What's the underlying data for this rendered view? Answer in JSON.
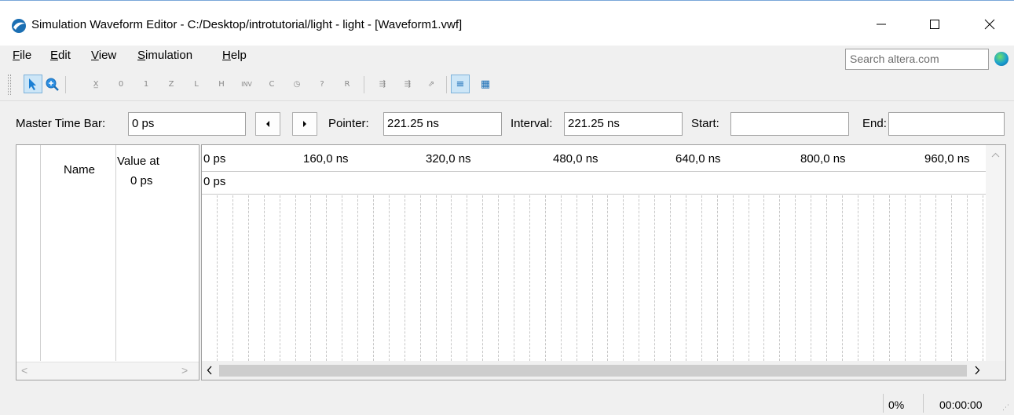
{
  "window": {
    "title": "Simulation Waveform Editor - C:/Desktop/introtutorial/light - light - [Waveform1.vwf]",
    "app_icon": "quartus-app-icon",
    "controls": [
      "minimize-icon",
      "maximize-icon",
      "close-icon"
    ]
  },
  "menu": {
    "items": [
      {
        "prefix": "",
        "u": "F",
        "rest": "ile"
      },
      {
        "prefix": "",
        "u": "E",
        "rest": "dit"
      },
      {
        "prefix": "",
        "u": "V",
        "rest": "iew"
      },
      {
        "prefix": "",
        "u": "S",
        "rest": "imulation"
      },
      {
        "prefix": "",
        "u": "H",
        "rest": "elp"
      }
    ],
    "search_placeholder": "Search altera.com"
  },
  "toolbar": {
    "buttons": [
      {
        "name": "selection-tool-icon",
        "glyph": "➤",
        "active": true
      },
      {
        "name": "zoom-tool-icon",
        "glyph": "🔍",
        "active": false
      },
      {
        "name": "uninitialized-value-icon",
        "glyph": "X̲",
        "active": false
      },
      {
        "name": "forcing-low-icon",
        "glyph": "0",
        "active": false
      },
      {
        "name": "forcing-high-icon",
        "glyph": "1",
        "active": false
      },
      {
        "name": "high-impedance-icon",
        "glyph": "Z",
        "active": false
      },
      {
        "name": "weak-low-icon",
        "glyph": "L",
        "active": false
      },
      {
        "name": "weak-high-icon",
        "glyph": "H",
        "active": false
      },
      {
        "name": "invert-icon",
        "glyph": "INV",
        "active": false
      },
      {
        "name": "count-value-icon",
        "glyph": "C",
        "active": false
      },
      {
        "name": "clock-icon",
        "glyph": "◷",
        "active": false
      },
      {
        "name": "arbitrary-value-icon",
        "glyph": "?",
        "active": false
      },
      {
        "name": "random-value-icon",
        "glyph": "R",
        "active": false
      },
      {
        "name": "run-functional-simulation-icon",
        "glyph": "⇶",
        "active": false
      },
      {
        "name": "run-timing-simulation-icon",
        "glyph": "⇶",
        "active": false
      },
      {
        "name": "generate-netlist-icon",
        "glyph": "⇗",
        "active": false
      },
      {
        "name": "waveform-display-icon",
        "glyph": "≡",
        "active": true
      },
      {
        "name": "grid-snap-icon",
        "glyph": "▦",
        "active": false
      }
    ]
  },
  "timebar": {
    "master_label": "Master Time Bar:",
    "master_value": "0 ps",
    "pointer_label": "Pointer:",
    "pointer_value": "221.25 ns",
    "interval_label": "Interval:",
    "interval_value": "221.25 ns",
    "start_label": "Start:",
    "start_value": "",
    "end_label": "End:",
    "end_value": ""
  },
  "signals": {
    "name_header": "Name",
    "value_header_line1": "Value at",
    "value_header_line2": "0 ps",
    "rows": []
  },
  "waveform": {
    "ruler_ticks": [
      "0 ps",
      "160,0 ns",
      "320,0 ns",
      "480,0 ns",
      "640,0 ns",
      "800,0 ns",
      "960,0 ns"
    ],
    "cursor_label": "0 ps"
  },
  "status": {
    "progress": "0%",
    "elapsed": "00:00:00"
  }
}
